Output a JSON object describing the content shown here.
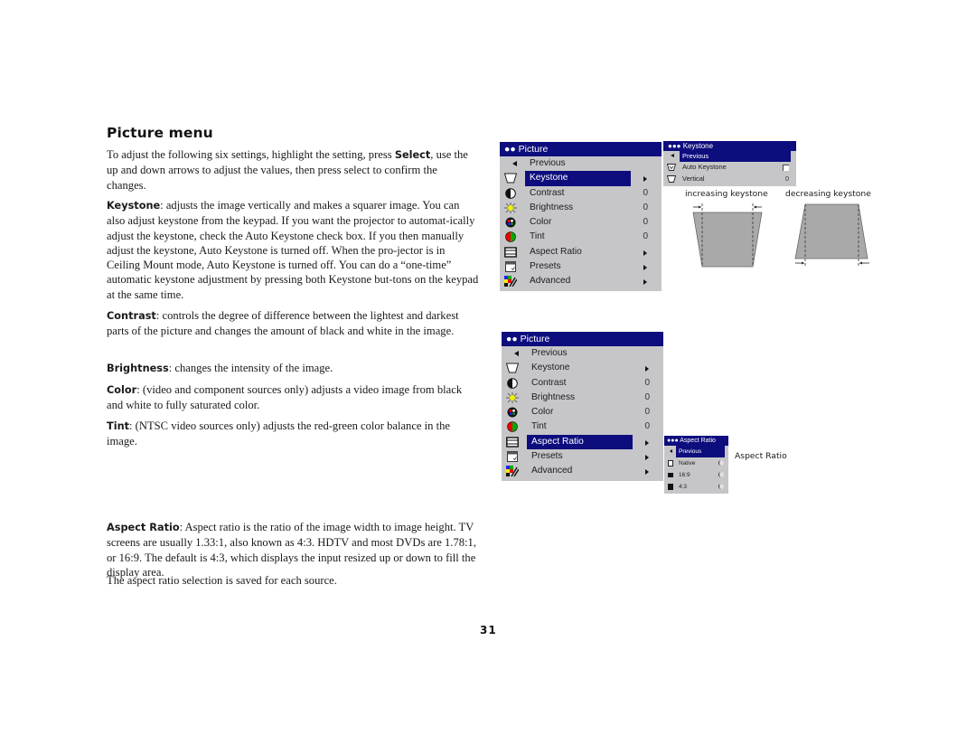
{
  "page": {
    "title": "Picture menu",
    "page_number": "31"
  },
  "paragraphs": {
    "intro": {
      "before": "To adjust the following six settings, highlight the setting, press ",
      "bold": "Select",
      "after": ", use the up and down arrows to adjust the values, then press select to confirm the changes."
    },
    "keystone": {
      "term": "Keystone",
      "text": ": adjusts the image vertically and makes a squarer image. You can also adjust keystone from the keypad. If you want the projector to automat-ically adjust the keystone, check the Auto Keystone check box. If you then manually adjust the keystone, Auto Keystone is turned off. When the pro-jector is in Ceiling Mount mode, Auto Keystone is turned off. You can do a “one-time” automatic keystone adjustment by pressing both Keystone but-tons on the keypad at the same time."
    },
    "contrast": {
      "term": "Contrast",
      "text": ": controls the degree of difference between the lightest and darkest parts of the picture and changes the amount of black and white in the image."
    },
    "brightness": {
      "term": "Brightness",
      "text": ": changes the intensity of the image."
    },
    "color": {
      "term": "Color",
      "text": ": (video and component sources only) adjusts a video image from black and white to fully saturated color."
    },
    "tint": {
      "term": "Tint",
      "text": ": (NTSC video sources only) adjusts the red-green color balance in the image."
    },
    "aspect": {
      "term": "Aspect Ratio",
      "text": ": Aspect ratio is the ratio of the image width to image height. TV screens are usually 1.33:1, also known as 4:3. HDTV and most DVDs are 1.78:1, or 16:9. The default is 4:3, which displays the input resized up or down to fill the display area."
    },
    "aspect_note": "The aspect ratio selection is saved for each source."
  },
  "picture_menu": {
    "header": "●● Picture",
    "items": [
      {
        "label": "Previous",
        "icon": "previous-arrow-icon",
        "value": "",
        "submenu": false
      },
      {
        "label": "Keystone",
        "icon": "keystone-icon",
        "value": "",
        "submenu": true
      },
      {
        "label": "Contrast",
        "icon": "contrast-icon",
        "value": "0",
        "submenu": false
      },
      {
        "label": "Brightness",
        "icon": "brightness-icon",
        "value": "0",
        "submenu": false
      },
      {
        "label": "Color",
        "icon": "color-icon",
        "value": "0",
        "submenu": false
      },
      {
        "label": "Tint",
        "icon": "tint-icon",
        "value": "0",
        "submenu": false
      },
      {
        "label": "Aspect Ratio",
        "icon": "aspect-ratio-icon",
        "value": "",
        "submenu": true
      },
      {
        "label": "Presets",
        "icon": "presets-icon",
        "value": "",
        "submenu": true
      },
      {
        "label": "Advanced",
        "icon": "advanced-icon",
        "value": "",
        "submenu": true
      }
    ],
    "menu1_selected": "Keystone",
    "menu2_selected": "Aspect Ratio"
  },
  "keystone_menu": {
    "header": "●●● Keystone",
    "items": [
      {
        "label": "Previous",
        "selected": true
      },
      {
        "label": "Auto Keystone",
        "control": "checkbox",
        "checked": false
      },
      {
        "label": "Vertical",
        "value": "0"
      }
    ]
  },
  "aspect_menu": {
    "header": "●●● Aspect Ratio",
    "items": [
      {
        "label": "Previous",
        "selected": true
      },
      {
        "label": "Native",
        "control": "radio"
      },
      {
        "label": "16:9",
        "control": "radio"
      },
      {
        "label": "4:3",
        "control": "radio"
      }
    ]
  },
  "captions": {
    "increasing": "increasing keystone",
    "decreasing": "decreasing keystone",
    "aspect": "Aspect Ratio"
  },
  "colors": {
    "menu_bg": "#c6c6c9",
    "highlight": "#0d0d7e",
    "diagram_fill": "#a9a9a9"
  }
}
